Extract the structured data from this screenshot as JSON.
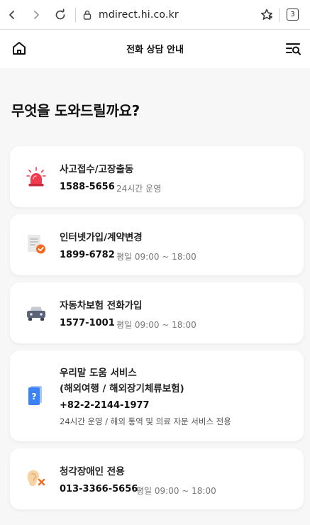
{
  "browser": {
    "url": "mdirect.hi.co.kr",
    "tab_count": "3"
  },
  "header": {
    "title": "전화 상담 안내"
  },
  "main": {
    "heading": "무엇을 도와드릴까요?",
    "cards": [
      {
        "icon": "siren-icon",
        "title": "사고접수/고장출동",
        "phone": "1588-5656",
        "hours": "24시간 운영"
      },
      {
        "icon": "document-check-icon",
        "title": "인터넷가입/계약변경",
        "phone": "1899-6782",
        "hours": "평일 09:00 ~ 18:00"
      },
      {
        "icon": "car-icon",
        "title": "자동차보험 전화가입",
        "phone": "1577-1001",
        "hours": "평일 09:00 ~ 18:00"
      },
      {
        "icon": "question-book-icon",
        "title": "우리말 도움 서비스",
        "subtitle": "(해외여행 / 해외장기체류보험)",
        "phone": "+82-2-2144-1977",
        "note": "24시간 운영 / 해외 통역 및 의료 자문 서비스 전용"
      },
      {
        "icon": "hearing-impaired-icon",
        "title": "청각장애인 전용",
        "phone": "013-3366-5656",
        "hours": "평일 09:00 ~ 18:00"
      }
    ]
  },
  "colors": {
    "accent_orange": "#f26b21",
    "siren_red": "#ef3b4e",
    "doc_blue": "#3b82f6",
    "car_gray": "#5b6476"
  }
}
